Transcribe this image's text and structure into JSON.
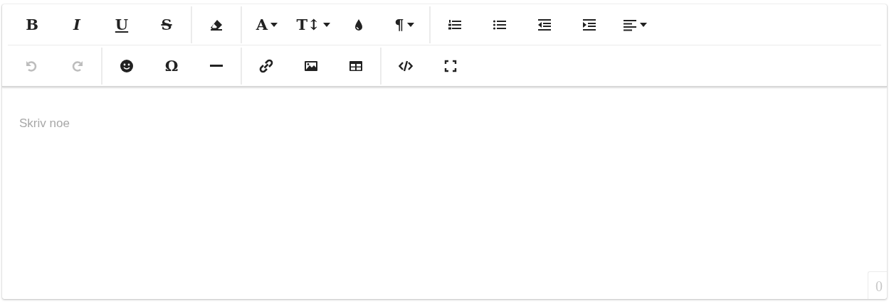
{
  "toolbar": {
    "rows": [
      {
        "groups": [
          {
            "items": [
              {
                "glyph": "B",
                "dropdown": false,
                "disabled": false
              },
              {
                "glyph": "I",
                "dropdown": false,
                "disabled": false
              },
              {
                "glyph": "U",
                "dropdown": false,
                "disabled": false
              },
              {
                "glyph": "S",
                "dropdown": false,
                "disabled": false
              }
            ]
          },
          {
            "items": [
              {
                "dropdown": false,
                "disabled": false
              }
            ]
          },
          {
            "items": [
              {
                "glyph": "A",
                "dropdown": true,
                "disabled": false
              },
              {
                "glyph": "T↕",
                "dropdown": true,
                "disabled": false
              },
              {
                "dropdown": false,
                "disabled": false
              },
              {
                "glyph": "¶",
                "dropdown": true,
                "disabled": false
              }
            ]
          },
          {
            "items": [
              {
                "dropdown": false,
                "disabled": false
              },
              {
                "dropdown": false,
                "disabled": false
              },
              {
                "dropdown": false,
                "disabled": false
              },
              {
                "dropdown": false,
                "disabled": false
              },
              {
                "dropdown": true,
                "disabled": false
              }
            ]
          }
        ]
      },
      {
        "groups": [
          {
            "items": [
              {
                "dropdown": false,
                "disabled": true
              },
              {
                "dropdown": false,
                "disabled": true
              }
            ]
          },
          {
            "items": [
              {
                "dropdown": false,
                "disabled": false
              },
              {
                "glyph": "Ω",
                "dropdown": false,
                "disabled": false
              },
              {
                "dropdown": false,
                "disabled": false
              }
            ]
          },
          {
            "items": [
              {
                "dropdown": false,
                "disabled": false
              },
              {
                "dropdown": false,
                "disabled": false
              },
              {
                "dropdown": false,
                "disabled": false
              }
            ]
          },
          {
            "items": [
              {
                "dropdown": false,
                "disabled": false
              },
              {
                "dropdown": false,
                "disabled": false
              }
            ]
          }
        ]
      }
    ]
  },
  "editor": {
    "placeholder": "Skriv noe"
  },
  "counter": "0"
}
